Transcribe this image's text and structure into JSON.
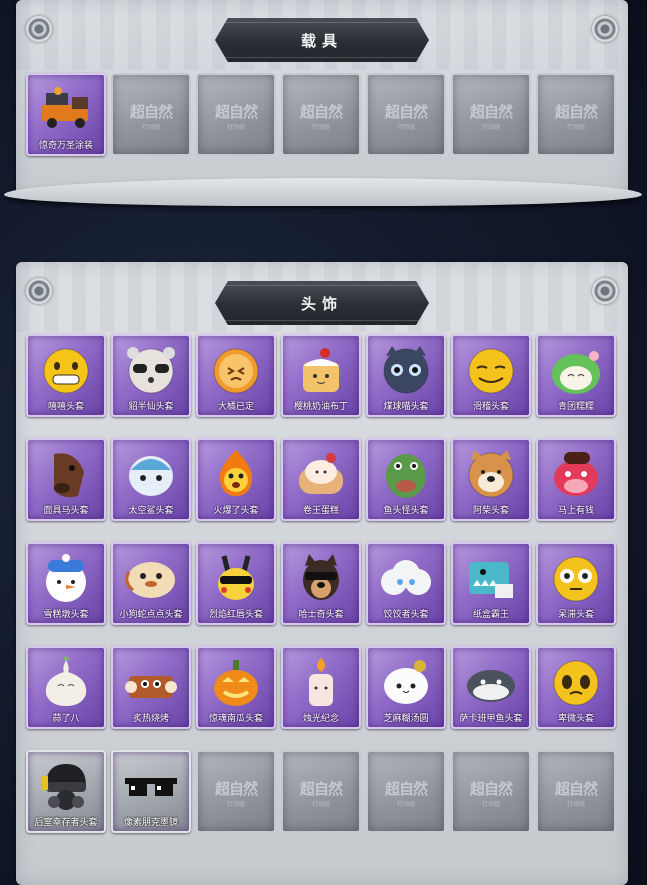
{
  "vehicle_section": {
    "title": "载具",
    "items": [
      {
        "name": "惊奇万圣涂装",
        "icon": "halloween-truck-icon",
        "state": "owned"
      },
      {
        "state": "empty",
        "watermark": "超自然",
        "watermark_sub": "行动组"
      },
      {
        "state": "empty",
        "watermark": "超自然",
        "watermark_sub": "行动组"
      },
      {
        "state": "empty",
        "watermark": "超自然",
        "watermark_sub": "行动组"
      },
      {
        "state": "empty",
        "watermark": "超自然",
        "watermark_sub": "行动组"
      },
      {
        "state": "empty",
        "watermark": "超自然",
        "watermark_sub": "行动组"
      },
      {
        "state": "empty",
        "watermark": "超自然",
        "watermark_sub": "行动组"
      }
    ]
  },
  "headwear_section": {
    "title": "头饰",
    "items": [
      {
        "name": "嘻嘻头套",
        "icon": "grinning-face-icon"
      },
      {
        "name": "貂半仙头套",
        "icon": "raccoon-sunglasses-icon"
      },
      {
        "name": "大橘已定",
        "icon": "orange-slice-icon"
      },
      {
        "name": "樱桃奶油布丁",
        "icon": "cherry-pudding-icon"
      },
      {
        "name": "煤球喵头套",
        "icon": "black-cat-icon"
      },
      {
        "name": "滑稽头套",
        "icon": "smirk-face-icon"
      },
      {
        "name": "青团糯糯",
        "icon": "green-dumpling-icon"
      },
      {
        "name": "面具马头套",
        "icon": "horse-mask-icon"
      },
      {
        "name": "太空鲨头套",
        "icon": "space-shark-icon"
      },
      {
        "name": "火爆了头套",
        "icon": "fire-spirit-icon"
      },
      {
        "name": "卷王蛋糕",
        "icon": "roll-cake-icon"
      },
      {
        "name": "鱼头怪头套",
        "icon": "fish-head-icon"
      },
      {
        "name": "阿柴头套",
        "icon": "shiba-dog-icon"
      },
      {
        "name": "马上有钱",
        "icon": "red-horse-icon"
      },
      {
        "name": "雪糕墩头套",
        "icon": "snowman-icon"
      },
      {
        "name": "小狗蛇点点头套",
        "icon": "puppy-snake-icon"
      },
      {
        "name": "烈焰红唇头套",
        "icon": "pikachu-shades-icon"
      },
      {
        "name": "哈士奇头套",
        "icon": "husky-shades-icon"
      },
      {
        "name": "饺饺者头套",
        "icon": "cloud-dumpling-icon"
      },
      {
        "name": "纸盒霸王",
        "icon": "box-dino-icon"
      },
      {
        "name": "呆滞头套",
        "icon": "stunned-face-icon"
      },
      {
        "name": "蒜了八",
        "icon": "garlic-icon"
      },
      {
        "name": "炙热烧烤",
        "icon": "grill-meat-icon"
      },
      {
        "name": "惊魂南瓜头套",
        "icon": "jack-o-lantern-icon"
      },
      {
        "name": "烛光纪念",
        "icon": "candle-icon"
      },
      {
        "name": "芝麻糊汤圆",
        "icon": "rice-ball-icon"
      },
      {
        "name": "萨卡班甲鱼头套",
        "icon": "sacabambaspis-icon"
      },
      {
        "name": "卑微头套",
        "icon": "pleading-face-icon"
      },
      {
        "name": "后室幸存者头套",
        "icon": "gas-mask-helmet-icon",
        "frame": "silver"
      },
      {
        "name": "像素朋克墨镜",
        "icon": "pixel-sunglasses-icon",
        "frame": "silver"
      },
      {
        "state": "empty",
        "watermark": "超自然",
        "watermark_sub": "行动组"
      },
      {
        "state": "empty",
        "watermark": "超自然",
        "watermark_sub": "行动组"
      },
      {
        "state": "empty",
        "watermark": "超自然",
        "watermark_sub": "行动组"
      },
      {
        "state": "empty",
        "watermark": "超自然",
        "watermark_sub": "行动组"
      },
      {
        "state": "empty",
        "watermark": "超自然",
        "watermark_sub": "行动组"
      }
    ]
  }
}
